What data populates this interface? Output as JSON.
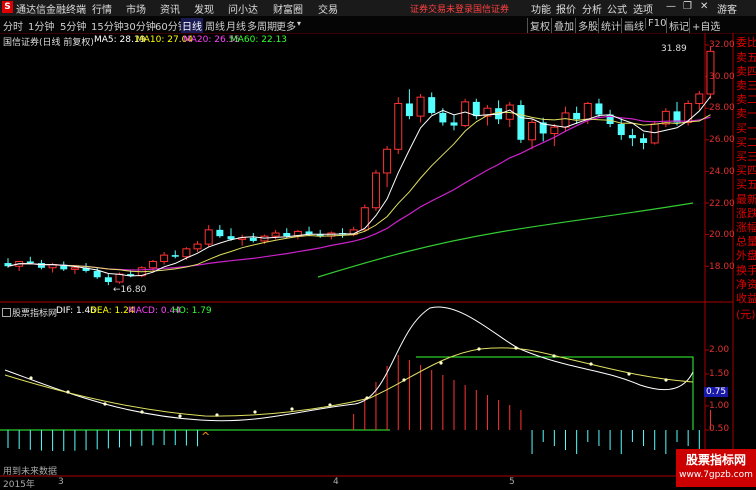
{
  "titlebar": {
    "logo": "S",
    "app_name": "通达信金融终端",
    "menu": [
      "行情",
      "市场",
      "资讯",
      "发现",
      "问小达",
      "财富圈",
      "交易"
    ],
    "notice_login": "证券交易未登录",
    "notice_broker": "国信证券",
    "right_menu": [
      "功能",
      "报价",
      "分析",
      "公式",
      "选项"
    ],
    "guest": "游客"
  },
  "toolbar": {
    "periods": [
      "分时",
      "1分钟",
      "5分钟",
      "15分钟",
      "30分钟",
      "60分钟",
      "日线",
      "周线",
      "月线",
      "多周期",
      "更多"
    ],
    "selected": "日线",
    "right_buttons": [
      "复权",
      "叠加",
      "多股",
      "统计",
      "画线",
      "F10",
      "标记",
      "+自选"
    ]
  },
  "main_info": {
    "name": "国信证券(日线 前复权)",
    "ma5": "MA5: 28.19",
    "ma10": "MA10: 27.04",
    "ma20": "MA20: 26.55",
    "ma60": "MA60: 22.13"
  },
  "price_axis": [
    "32.00",
    "30.00",
    "28.00",
    "26.00",
    "24.00",
    "22.00",
    "20.00",
    "18.00"
  ],
  "annotations": {
    "high": "31.89",
    "low": "16.80"
  },
  "right_panel": [
    "委比",
    "卖五",
    "卖四",
    "卖三",
    "卖二",
    "卖一",
    "买一",
    "买二",
    "买三",
    "买四",
    "买五",
    "最新",
    "涨跌",
    "涨幅",
    "总量",
    "外盘",
    "换手",
    "净资",
    "收益",
    "(元)"
  ],
  "macd_info": {
    "name": "股票指标网",
    "dif": "DIF: 1.46",
    "dea": "DEA: 1.24",
    "macd": "MACD: 0.44",
    "ho": "HO: 1.79"
  },
  "macd_axis": [
    "2.00",
    "1.50",
    "1.00",
    "0.50"
  ],
  "macd_current": "0.75",
  "bottom": {
    "note": "用到未来数据",
    "year": "2015年",
    "marks": [
      "3",
      "4",
      "5"
    ]
  },
  "watermark": {
    "line1": "股票指标网",
    "line2": "www.7gpzb.com"
  },
  "colors": {
    "up": "#ff3232",
    "down": "#54ffff",
    "ma5": "#ffffff",
    "ma10": "#ffff00",
    "ma20": "#ff00ff",
    "ma60": "#00ff00",
    "axis": "#aa0000"
  }
}
